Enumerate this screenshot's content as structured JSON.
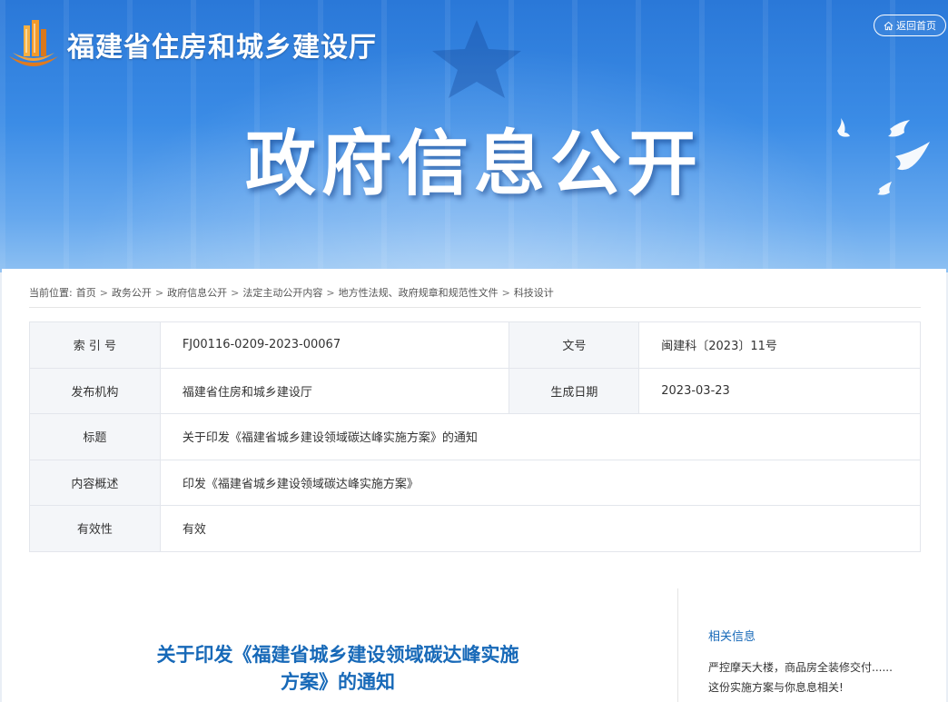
{
  "header": {
    "site_title": "福建省住房和城乡建设厅",
    "home_button": "返回首页",
    "banner_title": "政府信息公开"
  },
  "breadcrumb": {
    "prefix": "当前位置:",
    "items": [
      "首页",
      "政务公开",
      "政府信息公开",
      "法定主动公开内容",
      "地方性法规、政府规章和规范性文件",
      "科技设计"
    ],
    "separator": ">"
  },
  "meta": {
    "index_label": "索 引 号",
    "index_value": "FJ00116-0209-2023-00067",
    "docno_label": "文号",
    "docno_value": "闽建科〔2023〕11号",
    "org_label": "发布机构",
    "org_value": "福建省住房和城乡建设厅",
    "date_label": "生成日期",
    "date_value": "2023-03-23",
    "title_label": "标题",
    "title_value": "关于印发《福建省城乡建设领域碳达峰实施方案》的通知",
    "summary_label": "内容概述",
    "summary_value": "印发《福建省城乡建设领域碳达峰实施方案》",
    "validity_label": "有效性",
    "validity_value": "有效"
  },
  "document": {
    "title_line1": "关于印发《福建省城乡建设领域碳达峰实施",
    "title_line2": "方案》的通知"
  },
  "related": {
    "heading": "相关信息",
    "line1": "严控摩天大楼，商品房全装修交付......",
    "line2": "这份实施方案与你息息相关!"
  },
  "colors": {
    "accent": "#1769b8",
    "banner_top": "#2a78d8",
    "banner_bottom": "#8dc0f2",
    "label_bg": "#f4f6f9"
  },
  "icons": {
    "logo": "building-logo-icon",
    "home": "home-icon",
    "star": "star-icon",
    "doves": "doves-icon"
  }
}
